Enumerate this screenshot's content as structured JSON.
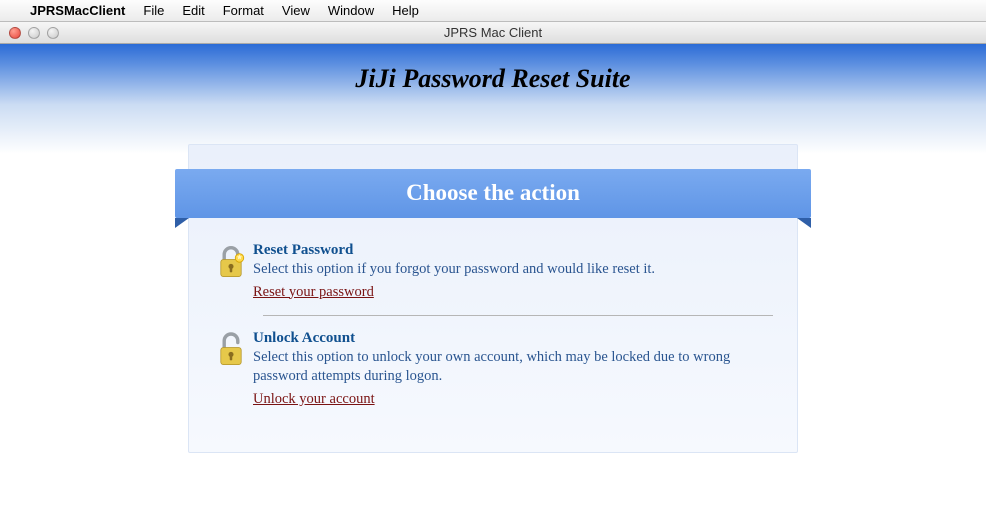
{
  "menubar": {
    "app_name": "JPRSMacClient",
    "items": [
      "File",
      "Edit",
      "Format",
      "View",
      "Window",
      "Help"
    ]
  },
  "window": {
    "title": "JPRS Mac Client"
  },
  "header": {
    "title": "JiJi Password Reset Suite"
  },
  "panel": {
    "banner": "Choose the action",
    "options": [
      {
        "title": "Reset Password",
        "desc": "Select this option if you forgot your password and would like reset it.",
        "link": "Reset your password"
      },
      {
        "title": "Unlock Account",
        "desc": "Select this option to unlock your own account, which may be locked due to wrong password attempts during logon.",
        "link": "Unlock your account"
      }
    ]
  }
}
